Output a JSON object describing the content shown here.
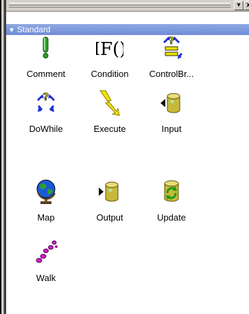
{
  "titlebar": {
    "dropdown_glyph": "▾",
    "close_glyph": "x"
  },
  "section": {
    "title": "Standard"
  },
  "tools": [
    {
      "label": "Comment",
      "icon": "exclamation-icon"
    },
    {
      "label": "Condition",
      "icon": "if-condition-icon"
    },
    {
      "label": "ControlBr...",
      "icon": "control-break-icon"
    },
    {
      "label": "DoWhile",
      "icon": "loop-arrows-icon"
    },
    {
      "label": "Execute",
      "icon": "lightning-icon"
    },
    {
      "label": "Input",
      "icon": "database-input-icon"
    },
    {
      "label": "Map",
      "icon": "globe-icon"
    },
    {
      "label": "Output",
      "icon": "database-output-icon"
    },
    {
      "label": "Update",
      "icon": "database-update-icon"
    },
    {
      "label": "Walk",
      "icon": "footprints-icon"
    }
  ],
  "colors": {
    "header_bg": "#7f99dd",
    "exclamation": "#2e9e2e",
    "loop_blue": "#1f2fd8",
    "lightning": "#f0e000",
    "cylinder": "#d8c84a",
    "walk": "#d020c8"
  }
}
